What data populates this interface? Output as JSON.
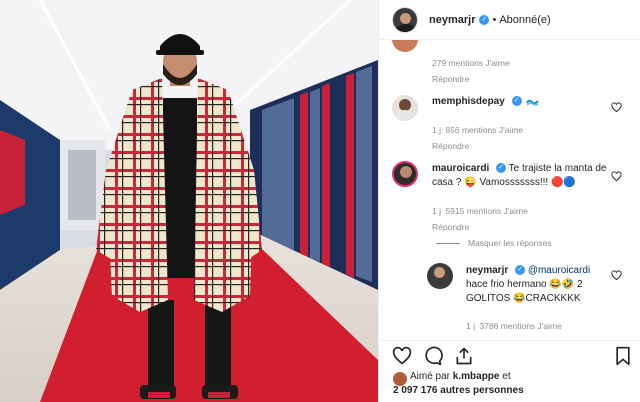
{
  "post_header": {
    "username": "neymarjr",
    "verified_glyph": "✓",
    "separator": "•",
    "follow_status": "Abonné(e)"
  },
  "comments": {
    "top_partial": {
      "likes": "279 mentions J'aime",
      "reply": "Répondre"
    },
    "memphis": {
      "username": "memphisdepay",
      "text_icon": "wave-emoji-icon",
      "time": "1 j",
      "likes": "856 mentions J'aime",
      "reply": "Répondre"
    },
    "mauro": {
      "username": "mauroicardi",
      "text": "Te trajiste la manta de casa ? 😜 Vamosssssss!!! 🔴🔵",
      "time": "1 j",
      "likes": "5915 mentions J'aime",
      "reply": "Répondre",
      "hide_replies": "Masquer les réponses"
    },
    "neymar_reply": {
      "username": "neymarjr",
      "mention": "@mauroicardi",
      "text": "hace frio hermano 😂🤣 2 GOLITOS 😂CRACKKKK",
      "time": "1 j",
      "likes": "3786 mentions J'aime"
    }
  },
  "likes_line": {
    "prefix": "Aimé par",
    "liker": "k.mbappe",
    "connector": "et",
    "count": "2 097 176 autres personnes"
  },
  "icons": {
    "like": "heart-icon",
    "comment": "comment-icon",
    "share": "share-icon",
    "save": "bookmark-icon",
    "verified": "verified-badge-icon"
  },
  "colors": {
    "verified_blue": "#3897f0",
    "muted_text": "#8e8e8e",
    "divider": "#efefef",
    "coat_red": "#c8283a"
  }
}
